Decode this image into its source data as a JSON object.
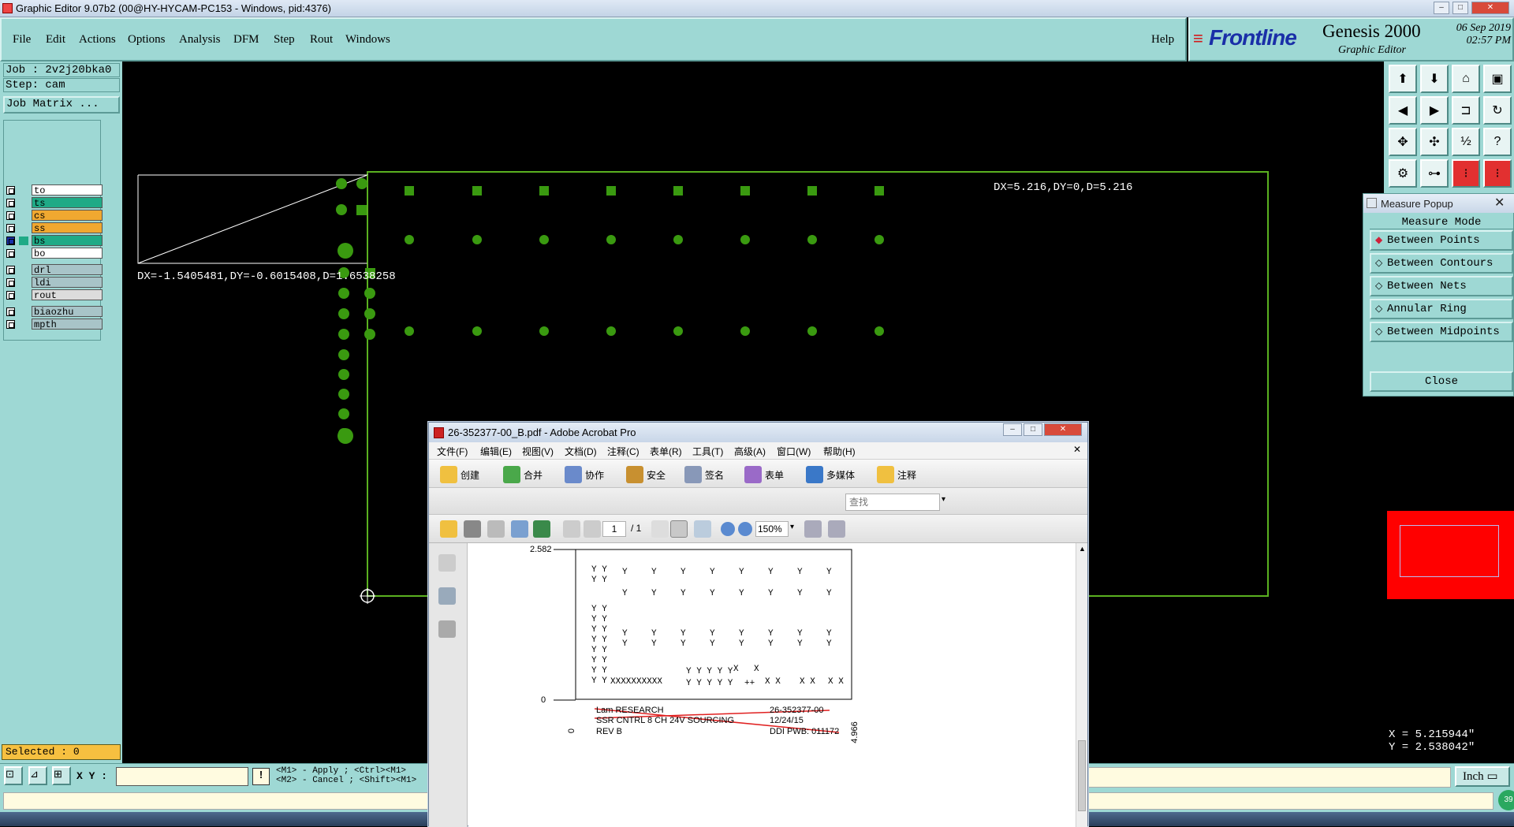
{
  "window": {
    "title": "Graphic Editor 9.07b2 (00@HY-HYCAM-PC153 - Windows, pid:4376)"
  },
  "menu": [
    "File",
    "Edit",
    "Actions",
    "Options",
    "Analysis",
    "DFM",
    "Step",
    "Rout",
    "Windows"
  ],
  "help_label": "Help",
  "brand": {
    "logo": "Frontline",
    "product": "Genesis 2000",
    "subtitle": "Graphic Editor",
    "date": "06 Sep 2019",
    "time": "02:57 PM"
  },
  "job": {
    "job_label": "Job : 2v2j20bka0",
    "step_label": "Step: cam",
    "matrix_button": "Job Matrix ..."
  },
  "layers": [
    {
      "name": "to",
      "color": "#ffffff"
    },
    {
      "name": "ts",
      "color": "#1faa86"
    },
    {
      "name": "cs",
      "color": "#f0a830"
    },
    {
      "name": "ss",
      "color": "#f0a830"
    },
    {
      "name": "bs",
      "color": "#1faa86"
    },
    {
      "name": "bo",
      "color": "#ffffff"
    },
    {
      "name": "drl",
      "color": "#a8c4c8"
    },
    {
      "name": "ldi",
      "color": "#a8c4c8"
    },
    {
      "name": "rout",
      "color": "#dcdcdc"
    },
    {
      "name": "biaozhu",
      "color": "#a8c4c8"
    },
    {
      "name": "mpth",
      "color": "#a8c4c8"
    }
  ],
  "selected_label": "Selected : 0",
  "canvas": {
    "measure_text_1": "DX=5.216,DY=0,D=5.216",
    "measure_text_2": "DX=-1.5405481,DY=-0.6015408,D=1.6538258",
    "pad_color": "#3a9a10",
    "outline_color": "#5ab020"
  },
  "measure_popup": {
    "title": "Measure Popup",
    "mode_label": "Measure Mode",
    "options": [
      "Between Points",
      "Between Contours",
      "Between Nets",
      "Annular Ring",
      "Between Midpoints"
    ],
    "close_label": "Close"
  },
  "coords": {
    "x": "X = 5.215944\"",
    "y": "Y = 2.538042\""
  },
  "bottom": {
    "xy_label": "X Y :",
    "xy_value": "",
    "hint1": "<M1> - Apply ; <Ctrl><M1>",
    "hint2": "<M2> - Cancel ; <Shift><M1>",
    "units": "Inch"
  },
  "acrobat": {
    "title": "26-352377-00_B.pdf - Adobe Acrobat Pro",
    "menu": [
      "文件(F)",
      "编辑(E)",
      "视图(V)",
      "文档(D)",
      "注释(C)",
      "表单(R)",
      "工具(T)",
      "高级(A)",
      "窗口(W)",
      "帮助(H)"
    ],
    "tools": [
      "创建",
      "合并",
      "协作",
      "安全",
      "签名",
      "表单",
      "多媒体",
      "注释"
    ],
    "search_placeholder": "查找",
    "page_current": "1",
    "page_total": "/ 1",
    "zoom": "150%",
    "doc": {
      "top_value": "2.582",
      "zero_value": "0",
      "bottom_zero": "0",
      "right_value": "4.966",
      "company": "Lam RESEARCH",
      "part_no": "26-352377-00",
      "desc": "SSR CNTRL 8 CH 24V SOURCING",
      "date": "12/24/15",
      "rev": "REV B",
      "ddi": "DDI PWB: 011172"
    }
  }
}
